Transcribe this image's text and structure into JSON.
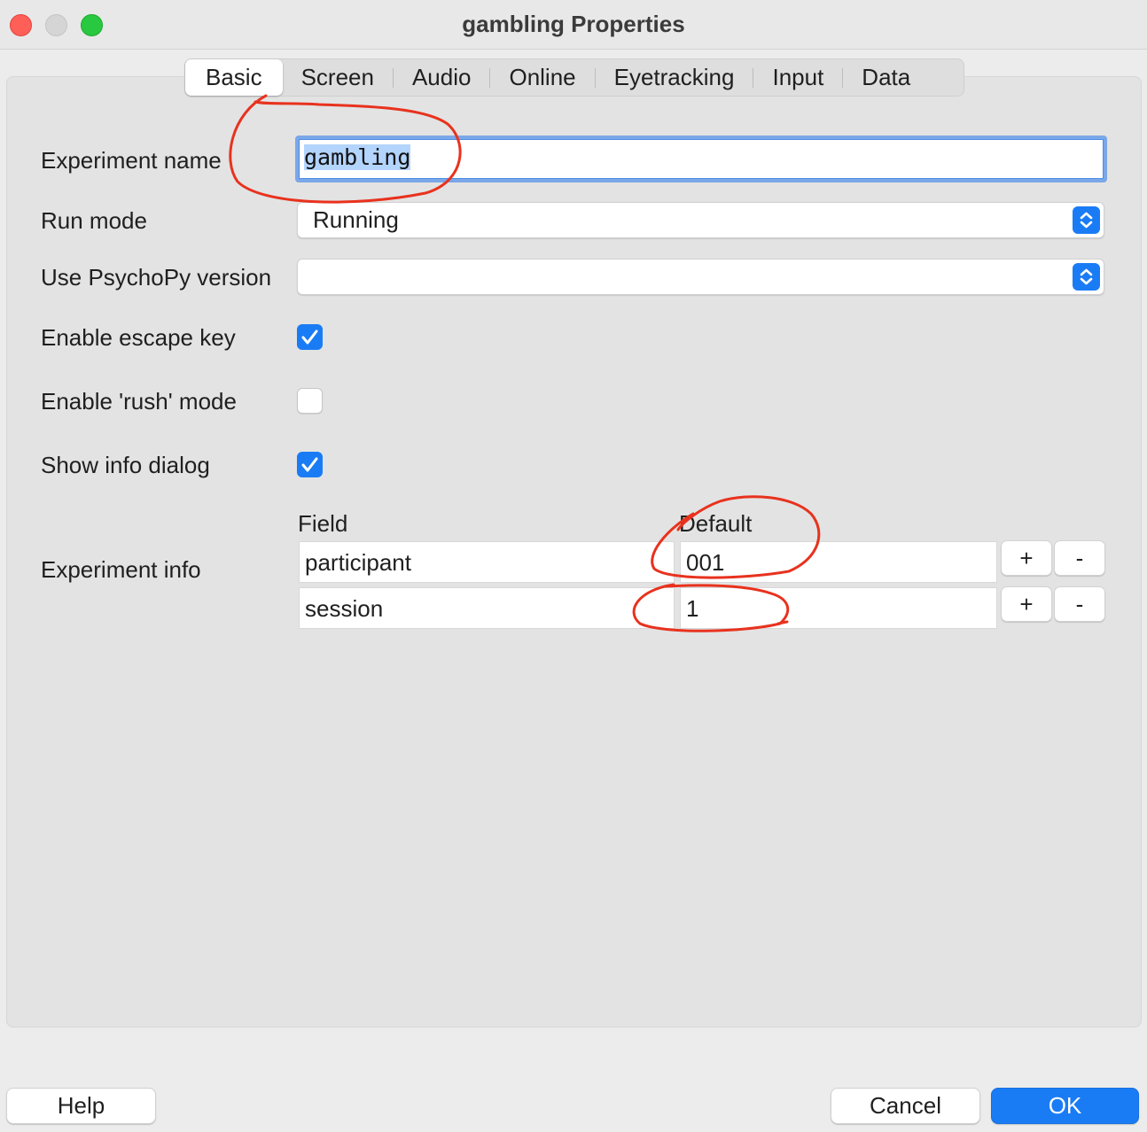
{
  "window": {
    "title": "gambling Properties"
  },
  "tabs": [
    {
      "label": "Basic",
      "active": true
    },
    {
      "label": "Screen",
      "active": false
    },
    {
      "label": "Audio",
      "active": false
    },
    {
      "label": "Online",
      "active": false
    },
    {
      "label": "Eyetracking",
      "active": false
    },
    {
      "label": "Input",
      "active": false
    },
    {
      "label": "Data",
      "active": false
    }
  ],
  "form": {
    "experiment_name": {
      "label": "Experiment name",
      "value": "gambling"
    },
    "run_mode": {
      "label": "Run mode",
      "value": "Running"
    },
    "psychopy_version": {
      "label": "Use PsychoPy version",
      "value": ""
    },
    "escape_key": {
      "label": "Enable escape key",
      "checked": true
    },
    "rush_mode": {
      "label": "Enable 'rush' mode",
      "checked": false
    },
    "info_dialog": {
      "label": "Show info dialog",
      "checked": true
    },
    "experiment_info": {
      "label": "Experiment info",
      "columns": [
        "Field",
        "Default"
      ],
      "rows": [
        {
          "field": "participant",
          "default": "001",
          "add": "+",
          "remove": "-"
        },
        {
          "field": "session",
          "default": "1",
          "add": "+",
          "remove": "-"
        }
      ]
    }
  },
  "buttons": {
    "help": "Help",
    "cancel": "Cancel",
    "ok": "OK"
  },
  "colors": {
    "accent": "#1a7cf5",
    "annotation": "#e8321e",
    "selection": "#b3d4fd"
  }
}
